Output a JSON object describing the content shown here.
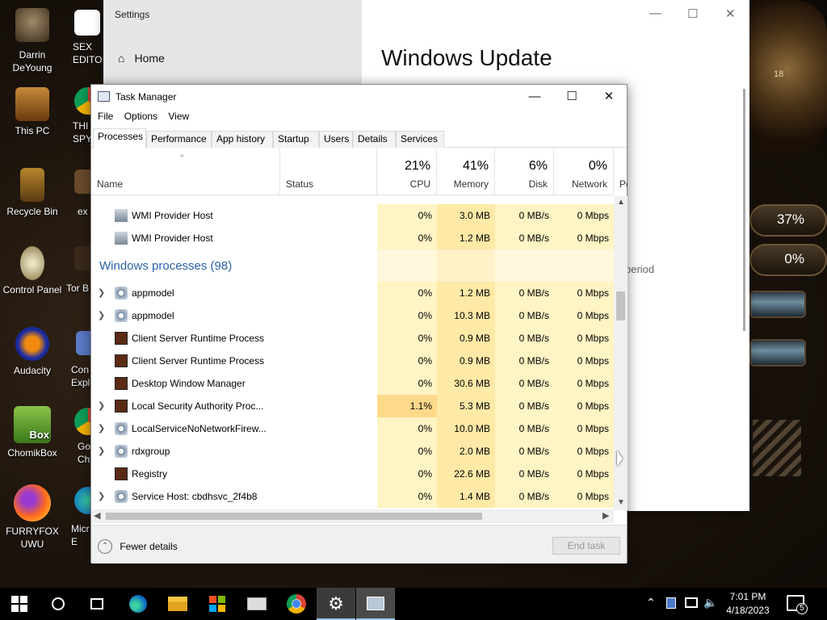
{
  "desktop": {
    "icons": [
      {
        "label": "Darrin\nDeYoung",
        "icon": "user-icon"
      },
      {
        "label": "This PC",
        "icon": "computer-icon"
      },
      {
        "label": "Recycle Bin",
        "icon": "recycle-bin-icon"
      },
      {
        "label": "Control Panel",
        "icon": "control-panel-icon"
      },
      {
        "label": "Audacity",
        "icon": "audacity-icon"
      },
      {
        "label": "ChomikBox",
        "icon": "chomikbox-icon"
      },
      {
        "label": "FURRYFOX\nUWU",
        "icon": "firefox-icon"
      }
    ],
    "partial_icons": [
      "SEX\nEDITO",
      "THI\nSPY",
      "ex",
      "Tor B",
      "Con\nExplo",
      "Go\nCh",
      "Micr\nE"
    ],
    "chomik_badge": "Box",
    "gauges": {
      "cpu": "37%",
      "mem": "0%"
    },
    "clock_dial": "18"
  },
  "settings": {
    "title": "Settings",
    "home_label": "Home",
    "page_title": "Windows Update",
    "partial_text": "period"
  },
  "taskmanager": {
    "title": "Task Manager",
    "menu": [
      "File",
      "Options",
      "View"
    ],
    "tabs": [
      "Processes",
      "Performance",
      "App history",
      "Startup",
      "Users",
      "Details",
      "Services"
    ],
    "columns": {
      "name": "Name",
      "status": "Status",
      "cpu": {
        "pct": "21%",
        "label": "CPU"
      },
      "memory": {
        "pct": "41%",
        "label": "Memory"
      },
      "disk": {
        "pct": "6%",
        "label": "Disk"
      },
      "network": {
        "pct": "0%",
        "label": "Network"
      },
      "power_partial": "Po"
    },
    "bg_rows": [
      {
        "name": "WMI Provider Host",
        "cpu": "0%",
        "mem": "3.0 MB",
        "disk": "0 MB/s",
        "net": "0 Mbps"
      },
      {
        "name": "WMI Provider Host",
        "cpu": "0%",
        "mem": "1.2 MB",
        "disk": "0 MB/s",
        "net": "0 Mbps"
      }
    ],
    "group_label": "Windows processes (98)",
    "win_rows": [
      {
        "name": "appmodel",
        "cpu": "0%",
        "mem": "1.2 MB",
        "disk": "0 MB/s",
        "net": "0 Mbps"
      },
      {
        "name": "appmodel",
        "cpu": "0%",
        "mem": "10.3 MB",
        "disk": "0 MB/s",
        "net": "0 Mbps"
      },
      {
        "name": "Client Server Runtime Process",
        "cpu": "0%",
        "mem": "0.9 MB",
        "disk": "0 MB/s",
        "net": "0 Mbps"
      },
      {
        "name": "Client Server Runtime Process",
        "cpu": "0%",
        "mem": "0.9 MB",
        "disk": "0 MB/s",
        "net": "0 Mbps"
      },
      {
        "name": "Desktop Window Manager",
        "cpu": "0%",
        "mem": "30.6 MB",
        "disk": "0 MB/s",
        "net": "0 Mbps"
      },
      {
        "name": "Local Security Authority Proc...",
        "cpu": "1.1%",
        "mem": "5.3 MB",
        "disk": "0 MB/s",
        "net": "0 Mbps"
      },
      {
        "name": "LocalServiceNoNetworkFirew...",
        "cpu": "0%",
        "mem": "10.0 MB",
        "disk": "0 MB/s",
        "net": "0 Mbps"
      },
      {
        "name": "rdxgroup",
        "cpu": "0%",
        "mem": "2.0 MB",
        "disk": "0 MB/s",
        "net": "0 Mbps"
      },
      {
        "name": "Registry",
        "cpu": "0%",
        "mem": "22.6 MB",
        "disk": "0 MB/s",
        "net": "0 Mbps"
      },
      {
        "name": "Service Host: cbdhsvc_2f4b8",
        "cpu": "0%",
        "mem": "1.4 MB",
        "disk": "0 MB/s",
        "net": "0 Mbps"
      }
    ],
    "fewer_details": "Fewer details",
    "end_task": "End task"
  },
  "taskbar": {
    "time": "7:01 PM",
    "date": "4/18/2023",
    "notification_count": "5"
  }
}
